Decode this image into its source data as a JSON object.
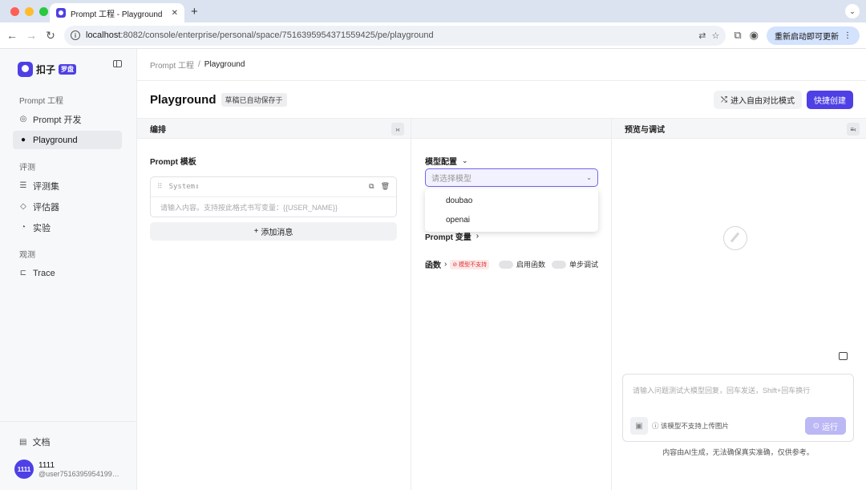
{
  "browser": {
    "tab_title": "Prompt 工程 - Playground",
    "url_host": "localhost",
    "url_rest": ":8082/console/enterprise/personal/space/7516395954371559425/pe/playground",
    "update_label": "重新启动即可更新"
  },
  "sidebar": {
    "brand": "扣子",
    "brand_badge": "罗盘",
    "sections": {
      "prompt": "Prompt 工程",
      "eval": "评测",
      "observe": "观测"
    },
    "items": {
      "prompt_dev": "Prompt 开发",
      "playground": "Playground",
      "dataset": "评测集",
      "evaluator": "评估器",
      "experiment": "实验",
      "trace": "Trace"
    },
    "docs": "文档",
    "user": {
      "avatar": "1111",
      "name": "1111",
      "id": "@user75163959541995..."
    }
  },
  "main": {
    "breadcrumb": {
      "parent": "Prompt 工程",
      "current": "Playground"
    },
    "title": "Playground",
    "draft_tag": "草稿已自动保存于",
    "compare_button": "进入自由对比模式",
    "quick_create_button": "快捷创建",
    "col_edit": "编排",
    "col_preview": "预览与调试",
    "template_label": "Prompt 模板",
    "message": {
      "role": "System",
      "placeholder": "请输入内容。支持按此格式书写变量：{{USER_NAME}}"
    },
    "add_message": "添加消息",
    "model_config_label": "模型配置",
    "model_select_placeholder": "请选择模型",
    "model_options": [
      "doubao",
      "openai"
    ],
    "prompt_vars_label": "Prompt 变量",
    "functions_label": "函数",
    "model_not_supported": "模型不支持",
    "enable_functions": "启用函数",
    "step_debug": "单步调试",
    "chat_placeholder": "请输入问题测试大模型回复，回车发送，Shift+回车换行",
    "image_not_supported": "该模型不支持上传图片",
    "run_button": "运行",
    "disclaimer": "内容由AI生成，无法确保真实准确，仅供参考。"
  }
}
